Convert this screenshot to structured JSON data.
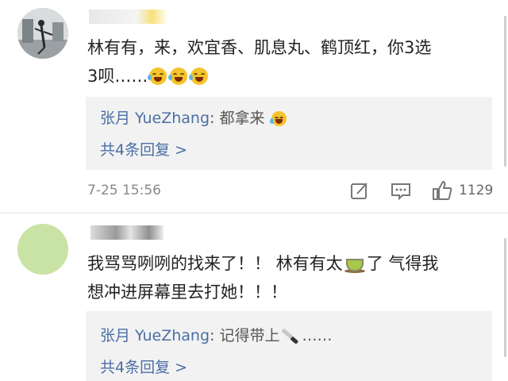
{
  "comments": [
    {
      "text_line1": "林有有，来，欢宜香、肌息丸、鹤顶红，你3选",
      "text_line2": "3呗……",
      "reply": {
        "author": "张月 YueZhang",
        "text": ": 都拿来",
        "count_label": "共4条回复 >"
      },
      "time": "7-25 15:56",
      "like_count": "1129",
      "icons": [
        "share-icon",
        "comment-icon",
        "like-icon"
      ]
    },
    {
      "text_line1": "我骂骂咧咧的找来了！！ 林有有太",
      "text_line1b": "了 气得我",
      "text_line2": "想冲进屏幕里去打她！！！",
      "reply": {
        "author": "张月 YueZhang",
        "text": ": 记得带上",
        "text_after": "……",
        "count_label": "共4条回复 >"
      }
    }
  ],
  "colors": {
    "accent_blue": "#4a6fa5",
    "reply_bg": "#f2f2f2",
    "text": "#222222",
    "meta": "#888888"
  }
}
